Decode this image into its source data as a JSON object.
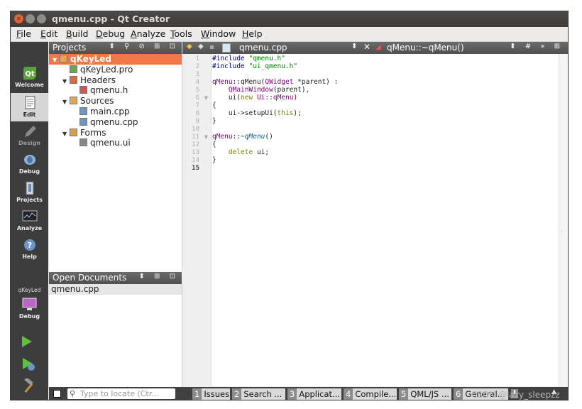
{
  "window": {
    "title": "qmenu.cpp - Qt Creator"
  },
  "menu": [
    "File",
    "Edit",
    "Build",
    "Debug",
    "Analyze",
    "Tools",
    "Window",
    "Help"
  ],
  "modes": [
    {
      "label": "Welcome",
      "icon": "qt-logo-icon"
    },
    {
      "label": "Edit",
      "icon": "edit-document-icon"
    },
    {
      "label": "Design",
      "icon": "design-pencil-icon"
    },
    {
      "label": "Debug",
      "icon": "debug-bug-icon"
    },
    {
      "label": "Projects",
      "icon": "projects-wrench-icon"
    },
    {
      "label": "Analyze",
      "icon": "analyze-monitor-icon"
    },
    {
      "label": "Help",
      "icon": "help-icon"
    }
  ],
  "kit": {
    "project": "qKeyLed",
    "mode": "Debug"
  },
  "projects_pane": {
    "title": "Projects",
    "tree": [
      {
        "label": "qKeyLed",
        "depth": 0,
        "arrow": "▼",
        "icon": "project-folder-icon",
        "selected": true
      },
      {
        "label": "qKeyLed.pro",
        "depth": 1,
        "arrow": "",
        "icon": "pro-file-icon",
        "selected": false
      },
      {
        "label": "Headers",
        "depth": 1,
        "arrow": "▼",
        "icon": "headers-folder-icon",
        "selected": false
      },
      {
        "label": "qmenu.h",
        "depth": 2,
        "arrow": "",
        "icon": "header-file-icon",
        "selected": false
      },
      {
        "label": "Sources",
        "depth": 1,
        "arrow": "▼",
        "icon": "sources-folder-icon",
        "selected": false
      },
      {
        "label": "main.cpp",
        "depth": 2,
        "arrow": "",
        "icon": "cpp-file-icon",
        "selected": false
      },
      {
        "label": "qmenu.cpp",
        "depth": 2,
        "arrow": "",
        "icon": "cpp-file-icon",
        "selected": false
      },
      {
        "label": "Forms",
        "depth": 1,
        "arrow": "▼",
        "icon": "forms-folder-icon",
        "selected": false
      },
      {
        "label": "qmenu.ui",
        "depth": 2,
        "arrow": "",
        "icon": "ui-file-icon",
        "selected": false
      }
    ]
  },
  "open_documents": {
    "title": "Open Documents",
    "items": [
      "qmenu.cpp"
    ]
  },
  "editor": {
    "file": "qmenu.cpp",
    "symbol": "qMenu::~qMenu()",
    "current_line": 15,
    "lines": [
      {
        "n": "1",
        "fold": "",
        "tokens": [
          {
            "t": "#include ",
            "c": "pp"
          },
          {
            "t": "\"qmenu.h\"",
            "c": "st"
          }
        ]
      },
      {
        "n": "2",
        "fold": "",
        "tokens": [
          {
            "t": "#include ",
            "c": "pp"
          },
          {
            "t": "\"ui_qmenu.h\"",
            "c": "st"
          }
        ]
      },
      {
        "n": "3",
        "fold": "",
        "tokens": []
      },
      {
        "n": "4",
        "fold": "",
        "tokens": [
          {
            "t": "qMenu",
            "c": "ty"
          },
          {
            "t": "::qMenu(",
            "c": ""
          },
          {
            "t": "QWidget",
            "c": "ty"
          },
          {
            "t": " *parent) :",
            "c": ""
          }
        ]
      },
      {
        "n": "5",
        "fold": "",
        "tokens": [
          {
            "t": "    ",
            "c": ""
          },
          {
            "t": "QMainWindow",
            "c": "ty"
          },
          {
            "t": "(parent),",
            "c": ""
          }
        ]
      },
      {
        "n": "6",
        "fold": "▼",
        "tokens": [
          {
            "t": "    ui(",
            "c": ""
          },
          {
            "t": "new",
            "c": "kw"
          },
          {
            "t": " ",
            "c": ""
          },
          {
            "t": "Ui",
            "c": "ty"
          },
          {
            "t": "::",
            "c": ""
          },
          {
            "t": "qMenu",
            "c": "ty"
          },
          {
            "t": ")",
            "c": ""
          }
        ]
      },
      {
        "n": "7",
        "fold": "",
        "tokens": [
          {
            "t": "{",
            "c": ""
          }
        ]
      },
      {
        "n": "8",
        "fold": "",
        "tokens": [
          {
            "t": "    ui->setupUi(",
            "c": ""
          },
          {
            "t": "this",
            "c": "kw"
          },
          {
            "t": ");",
            "c": ""
          }
        ]
      },
      {
        "n": "9",
        "fold": "",
        "tokens": [
          {
            "t": "}",
            "c": ""
          }
        ]
      },
      {
        "n": "10",
        "fold": "",
        "tokens": []
      },
      {
        "n": "11",
        "fold": "▼",
        "tokens": [
          {
            "t": "qMenu",
            "c": "ty"
          },
          {
            "t": "::~",
            "c": ""
          },
          {
            "t": "qMenu",
            "c": "it"
          },
          {
            "t": "()",
            "c": ""
          }
        ]
      },
      {
        "n": "12",
        "fold": "",
        "tokens": [
          {
            "t": "{",
            "c": ""
          }
        ]
      },
      {
        "n": "13",
        "fold": "",
        "tokens": [
          {
            "t": "    ",
            "c": ""
          },
          {
            "t": "delete",
            "c": "kw"
          },
          {
            "t": " ui;",
            "c": ""
          }
        ]
      },
      {
        "n": "14",
        "fold": "",
        "tokens": [
          {
            "t": "}",
            "c": ""
          }
        ]
      },
      {
        "n": "15",
        "fold": "",
        "tokens": []
      }
    ]
  },
  "statusbar": {
    "locator_placeholder": "Type to locate (Ctr...",
    "tabs": [
      {
        "num": "1",
        "label": "Issues"
      },
      {
        "num": "2",
        "label": "Search ..."
      },
      {
        "num": "3",
        "label": "Applicat..."
      },
      {
        "num": "4",
        "label": "Compile..."
      },
      {
        "num": "5",
        "label": "QML/JS ..."
      },
      {
        "num": "6",
        "label": "General..."
      }
    ]
  },
  "watermark": "CSDN @lazy_sleepzz",
  "colors": {
    "accent": "#f07746",
    "modebar": "#3d3d3d",
    "run": "#5ec13b"
  }
}
